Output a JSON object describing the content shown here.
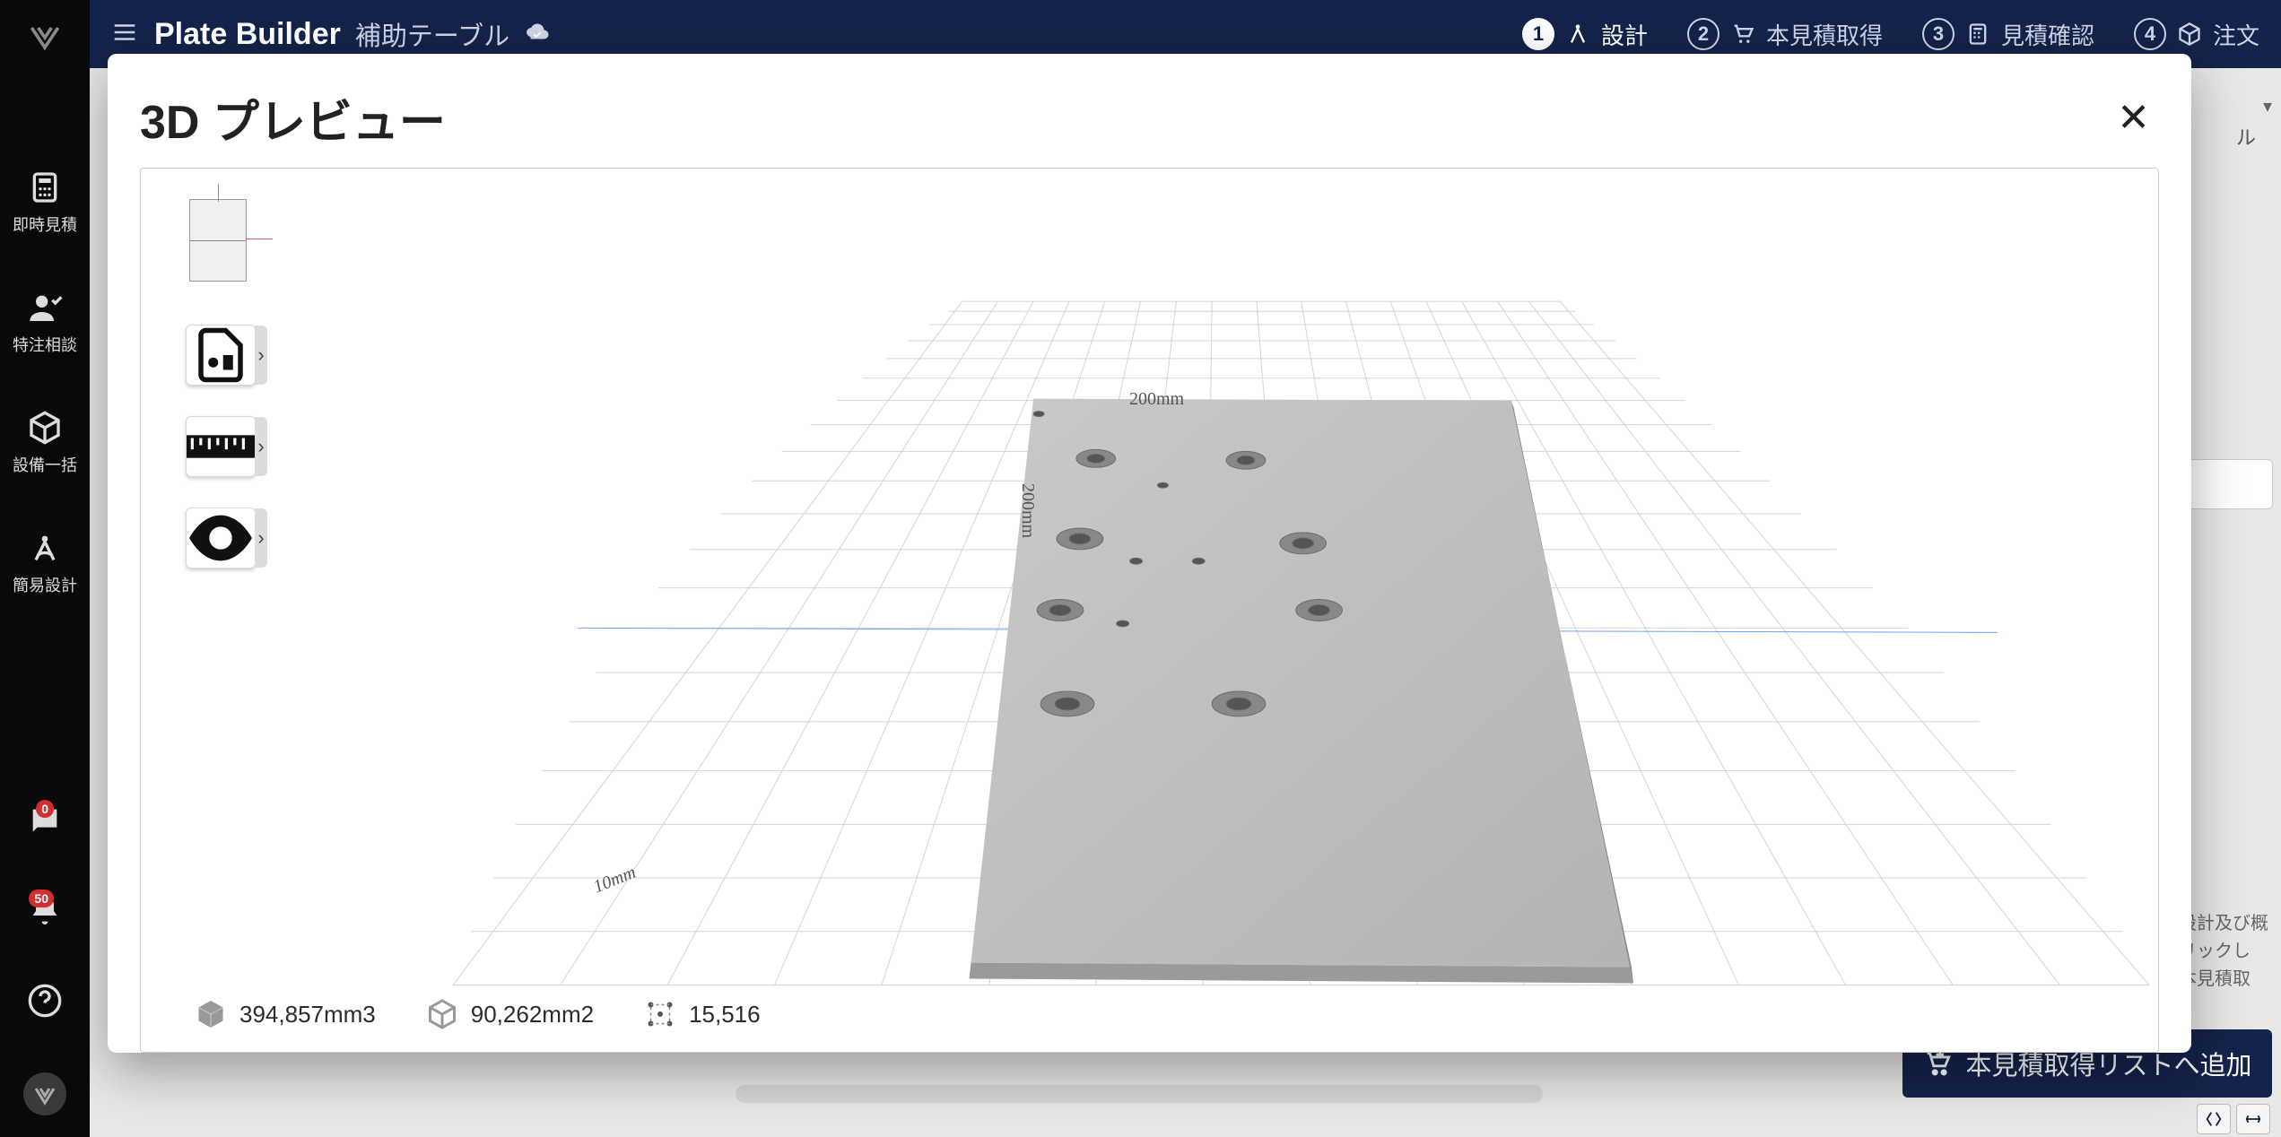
{
  "header": {
    "app_title": "Plate Builder",
    "doc_title": "補助テーブル",
    "steps": [
      {
        "num": "1",
        "label": "設計",
        "active": true
      },
      {
        "num": "2",
        "label": "本見積取得",
        "active": false
      },
      {
        "num": "3",
        "label": "見積確認",
        "active": false
      },
      {
        "num": "4",
        "label": "注文",
        "active": false
      }
    ]
  },
  "sidebar": {
    "items": [
      {
        "label": "即時見積"
      },
      {
        "label": "特注相談"
      },
      {
        "label": "設備一括"
      },
      {
        "label": "簡易設計"
      }
    ],
    "chat_badge": "0",
    "notif_badge": "50"
  },
  "modal": {
    "title": "3D プレビュー",
    "dims": {
      "width": "200mm",
      "depth": "200mm",
      "thickness": "10mm"
    },
    "stats": {
      "volume": "394,857mm3",
      "area": "90,262mm2",
      "points": "15,516"
    }
  },
  "background": {
    "dropdown_suffix": "ル",
    "cta_label": "本見積取得リストへ追加",
    "side_text": "設計及び概\nリックし\n本見積取"
  }
}
